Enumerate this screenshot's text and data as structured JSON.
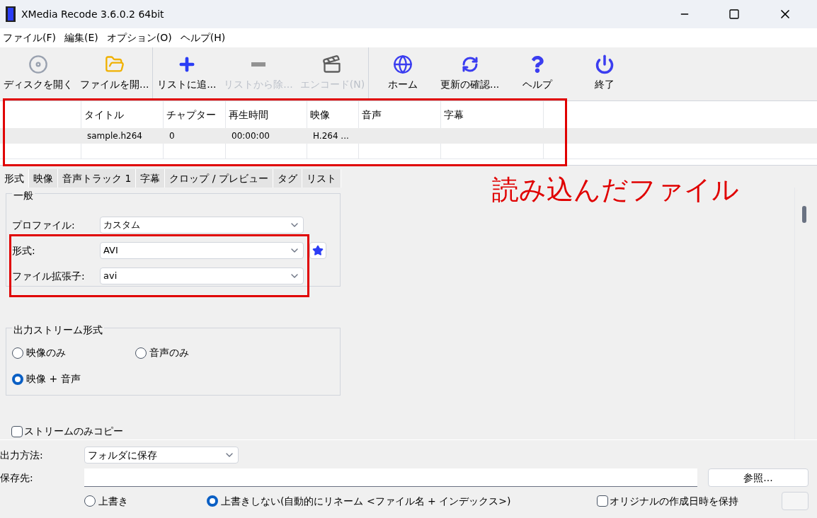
{
  "window": {
    "title": "XMedia Recode 3.6.0.2 64bit"
  },
  "menu": [
    "ファイル(F)",
    "編集(E)",
    "オプション(O)",
    "ヘルプ(H)"
  ],
  "toolbar": [
    {
      "label": "ディスクを開く",
      "disabled": false
    },
    {
      "label": "ファイルを開...",
      "disabled": false
    },
    {
      "label": "リストに追...",
      "disabled": false
    },
    {
      "label": "リストから除...",
      "disabled": true
    },
    {
      "label": "エンコード(N)",
      "disabled": true
    },
    {
      "label": "ホーム",
      "disabled": false
    },
    {
      "label": "更新の確認...",
      "disabled": false
    },
    {
      "label": "ヘルプ",
      "disabled": false
    },
    {
      "label": "終了",
      "disabled": false
    }
  ],
  "file_list": {
    "columns": [
      "タイトル",
      "チャプター",
      "再生時間",
      "映像",
      "音声",
      "字幕"
    ],
    "rows": [
      {
        "cells": [
          "sample.h264",
          "0",
          "00:00:00",
          "H.264 ..."
        ]
      }
    ]
  },
  "annotation": "読み込んだファイル",
  "tabs": [
    {
      "label": "形式",
      "selected": true
    },
    {
      "label": "映像",
      "selected": false
    },
    {
      "label": "音声トラック 1",
      "selected": false
    },
    {
      "label": "字幕",
      "selected": false
    },
    {
      "label": "クロップ / プレビュー",
      "selected": false
    },
    {
      "label": "タグ",
      "selected": false
    },
    {
      "label": "リスト",
      "selected": false
    }
  ],
  "general": {
    "title": "一般",
    "fields": [
      {
        "label": "プロファイル:",
        "value": "カスタム"
      },
      {
        "label": "形式:",
        "value": "AVI"
      },
      {
        "label": "ファイル拡張子:",
        "value": "avi"
      }
    ]
  },
  "stream": {
    "title": "出力ストリーム形式",
    "options": [
      {
        "label": "映像のみ",
        "selected": false
      },
      {
        "label": "音声のみ",
        "selected": false
      },
      {
        "label": "映像 + 音声",
        "selected": true
      }
    ]
  },
  "stream_copy": {
    "label": "ストリームのみコピー",
    "checked": false
  },
  "output": {
    "method_label": "出力方法:",
    "method": "フォルダに保存",
    "dest_label": "保存先:",
    "browse": "参照...",
    "overwrite": [
      {
        "label": "上書き",
        "selected": false
      },
      {
        "label": "上書きしない(自動的にリネーム <ファイル名 + インデックス>)",
        "selected": true
      }
    ],
    "keep_date": {
      "label": "オリジナルの作成日時を保持",
      "checked": false
    }
  }
}
